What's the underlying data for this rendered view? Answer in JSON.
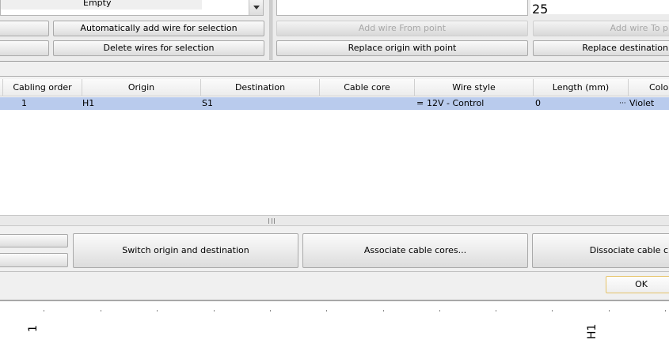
{
  "top": {
    "empty_value": "Empty",
    "preview_value": "25",
    "btn_auto_add": "Automatically add wire for selection",
    "btn_delete": "Delete wires for selection",
    "btn_add_from": "Add wire From point",
    "btn_add_to": "Add wire To p",
    "btn_replace_origin": "Replace origin with point",
    "btn_replace_dest": "Replace destination"
  },
  "table": {
    "headers": [
      "Cabling order",
      "Origin",
      "Destination",
      "Cable core",
      "Wire style",
      "Length (mm)",
      "Color"
    ],
    "row": {
      "order": "1",
      "origin": "H1",
      "destination": "S1",
      "cable_core": "",
      "wire_style_prefix": "=",
      "wire_style": "12V - Control",
      "length": "0",
      "color_prefix": "···",
      "color": "Violet"
    }
  },
  "actions": {
    "switch": "Switch origin and destination",
    "associate": "Associate cable cores...",
    "dissociate": "Dissociate cable c"
  },
  "footer": {
    "ok": "OK"
  },
  "drawing": {
    "label_left": "1",
    "label_right": "H1"
  },
  "colors": {
    "selection": "#b9cbed",
    "ok_border": "#e6c46a"
  }
}
